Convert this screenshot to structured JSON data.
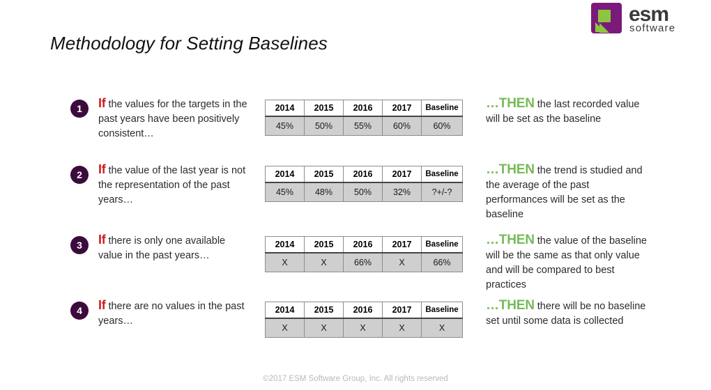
{
  "page_title": "Methodology for Setting Baselines",
  "logo": {
    "mark_name": "esm-arrow-mark",
    "brand": "esm",
    "tagline": "software",
    "purple": "#7B1A7B",
    "green": "#8CC63F"
  },
  "colors": {
    "badge_purple": "#3C0A3C",
    "if_red": "#CC1F1F",
    "then_green": "#76BB58",
    "table_value_bg": "#cfcfcf",
    "footer_gray": "#b9b9b9"
  },
  "table_headers": [
    "2014",
    "2015",
    "2016",
    "2017",
    "Baseline"
  ],
  "rows": [
    {
      "number": "1",
      "if_word": "If",
      "if_text": "the values for the targets in the past years have been positively consistent…",
      "values": [
        "45%",
        "50%",
        "55%",
        "60%",
        "60%"
      ],
      "then_word": "…THEN",
      "then_text": "the last recorded value will be set as the baseline"
    },
    {
      "number": "2",
      "if_word": "If",
      "if_text": "the value of the last year is not the representation of the past years…",
      "values": [
        "45%",
        "48%",
        "50%",
        "32%",
        "?+/-?"
      ],
      "then_word": "…THEN",
      "then_text": "the trend is studied and the average of the past performances will be set as the baseline"
    },
    {
      "number": "3",
      "if_word": "If",
      "if_text": "there is only one available value in the past years…",
      "values": [
        "X",
        "X",
        "66%",
        "X",
        "66%"
      ],
      "then_word": "…THEN",
      "then_text": "the value of the baseline will be the same as that only value  and will be compared to best practices"
    },
    {
      "number": "4",
      "if_word": "If",
      "if_text": "there are no values in the past years…",
      "values": [
        "X",
        "X",
        "X",
        "X",
        "X"
      ],
      "then_word": "…THEN",
      "then_text": "there will be no baseline set until some data is collected"
    }
  ],
  "footer": "©2017 ESM Software Group, Inc. All rights reserved"
}
